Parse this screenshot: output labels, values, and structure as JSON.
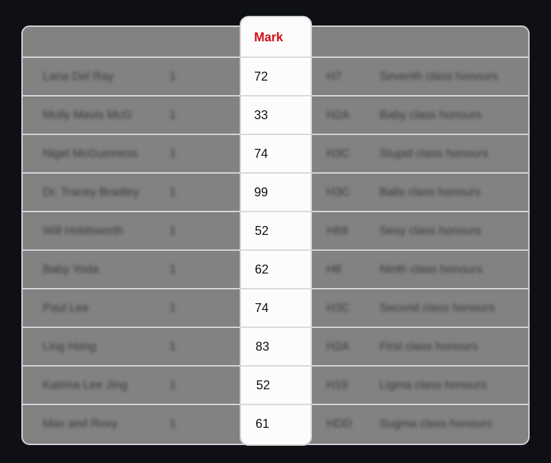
{
  "table": {
    "mark_header": "Mark",
    "rows": [
      {
        "name": "Lana Del Ray",
        "count": "1",
        "mark": "72",
        "grade": "H7",
        "class": "Seventh class honours"
      },
      {
        "name": "Molly Mavis McG",
        "count": "1",
        "mark": "33",
        "grade": "H2A",
        "class": "Baby class honours"
      },
      {
        "name": "Nigel McGuinness",
        "count": "1",
        "mark": "74",
        "grade": "H3C",
        "class": "Stupid class honours"
      },
      {
        "name": "Dr. Tracey Bradley",
        "count": "1",
        "mark": "99",
        "grade": "H3C",
        "class": "Balls class honours"
      },
      {
        "name": "Will Holdsworth",
        "count": "1",
        "mark": "52",
        "grade": "H69",
        "class": "Sexy class honours"
      },
      {
        "name": "Baby Yoda",
        "count": "1",
        "mark": "62",
        "grade": "H8",
        "class": "Ninth class honours"
      },
      {
        "name": "Paul Lee",
        "count": "1",
        "mark": "74",
        "grade": "H3C",
        "class": "Second class honours"
      },
      {
        "name": "Ling Hong",
        "count": "1",
        "mark": "83",
        "grade": "H2A",
        "class": "First class honours"
      },
      {
        "name": "Katrina Lee Jing",
        "count": "1",
        "mark": "52",
        "grade": "H19",
        "class": "Ligma class honours"
      },
      {
        "name": "Max and Roxy",
        "count": "1",
        "mark": "61",
        "grade": "HDD",
        "class": "Sugma class honours"
      }
    ]
  },
  "colors": {
    "page_background": "#0e1016",
    "table_background": "#838182",
    "mark_column_background": "#fdfcfd",
    "mark_header_text": "#d10f18"
  }
}
